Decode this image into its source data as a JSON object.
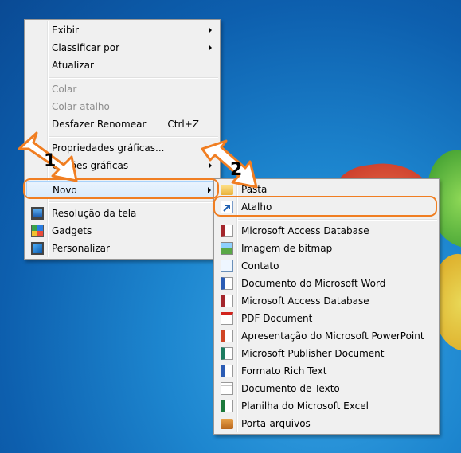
{
  "context_menu": {
    "items": [
      {
        "label": "Exibir",
        "submenu": true
      },
      {
        "label": "Classificar por",
        "submenu": true
      },
      {
        "label": "Atualizar"
      },
      {
        "label": "Colar",
        "disabled": true
      },
      {
        "label": "Colar atalho",
        "disabled": true
      },
      {
        "label": "Desfazer Renomear",
        "shortcut": "Ctrl+Z"
      },
      {
        "label": "Propriedades gráficas..."
      },
      {
        "label": "Opções gráficas",
        "submenu": true
      },
      {
        "label": "Novo",
        "submenu": true
      },
      {
        "label": "Resolução da tela",
        "icon": "monitor-icon"
      },
      {
        "label": "Gadgets",
        "icon": "gadgets-icon"
      },
      {
        "label": "Personalizar",
        "icon": "personalize-icon"
      }
    ]
  },
  "new_submenu": {
    "items": [
      {
        "label": "Pasta",
        "icon": "folder-icon"
      },
      {
        "label": "Atalho",
        "icon": "shortcut-icon"
      },
      {
        "label": "Microsoft Access Database",
        "icon": "access-icon"
      },
      {
        "label": "Imagem de bitmap",
        "icon": "bitmap-icon"
      },
      {
        "label": "Contato",
        "icon": "contact-icon"
      },
      {
        "label": "Documento do Microsoft Word",
        "icon": "word-icon"
      },
      {
        "label": "Microsoft Access Database",
        "icon": "access-icon"
      },
      {
        "label": "PDF Document",
        "icon": "pdf-icon"
      },
      {
        "label": "Apresentação do Microsoft PowerPoint",
        "icon": "powerpoint-icon"
      },
      {
        "label": "Microsoft Publisher Document",
        "icon": "publisher-icon"
      },
      {
        "label": "Formato Rich Text",
        "icon": "rtf-icon"
      },
      {
        "label": "Documento de Texto",
        "icon": "text-icon"
      },
      {
        "label": "Planilha do Microsoft Excel",
        "icon": "excel-icon"
      },
      {
        "label": "Porta-arquivos",
        "icon": "briefcase-icon"
      }
    ]
  },
  "callouts": {
    "step1": "1",
    "step2": "2"
  },
  "colors": {
    "highlight": "#f07e22",
    "desktop": "#1d86cf",
    "menu_bg": "#f0f0f0"
  }
}
